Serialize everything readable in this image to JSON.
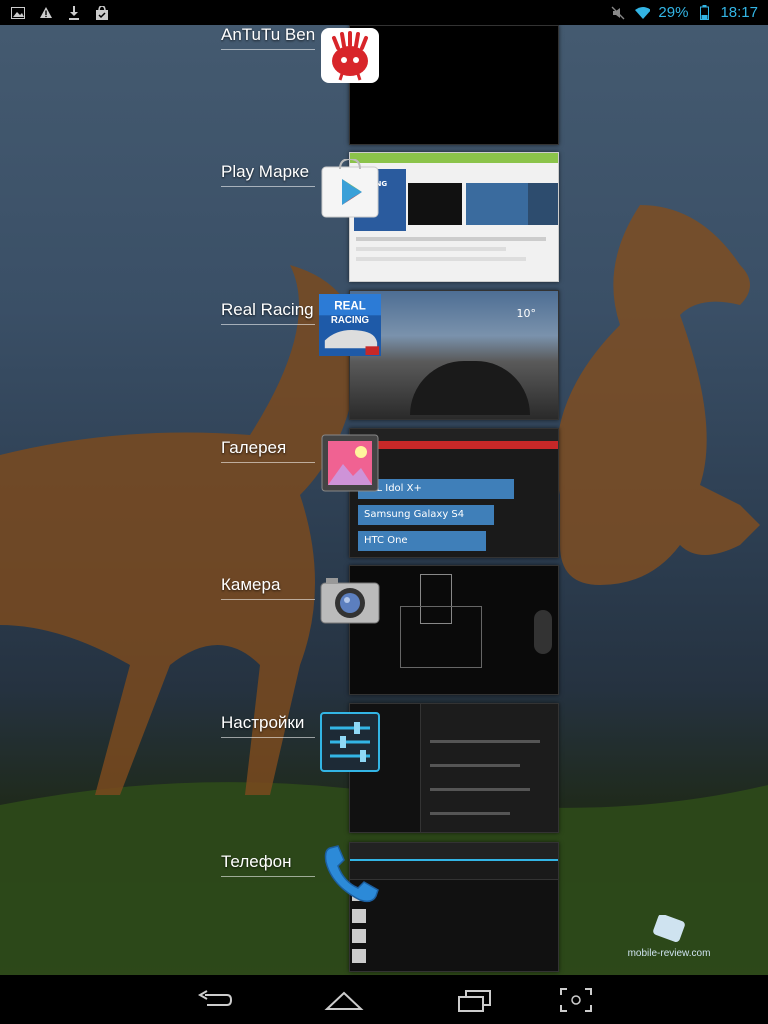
{
  "status_bar": {
    "battery_percent": "29%",
    "time": "18:17",
    "icons": [
      "gallery-notification-icon",
      "warning-icon",
      "download-icon",
      "store-bag-icon",
      "mute-icon",
      "wifi-icon",
      "battery-icon"
    ]
  },
  "recent_apps": [
    {
      "label": "AnTuTu Ben",
      "icon": "antutu-icon"
    },
    {
      "label": "Play Марке",
      "icon": "play-store-icon"
    },
    {
      "label": "Real Racing",
      "icon": "real-racing-icon"
    },
    {
      "label": "Галерея",
      "icon": "gallery-icon"
    },
    {
      "label": "Камера",
      "icon": "camera-icon"
    },
    {
      "label": "Настройки",
      "icon": "settings-icon"
    },
    {
      "label": "Телефон",
      "icon": "phone-icon"
    }
  ],
  "gallery_thumb": {
    "bars": [
      "TCL Idol X+",
      "Samsung Galaxy S4",
      "HTC One"
    ]
  },
  "play_thumb": {
    "banner": "REAL RACING"
  },
  "racing_thumb": {
    "speed": "10°"
  },
  "nav_bar": {
    "buttons": [
      "back-button",
      "home-button",
      "recent-apps-button",
      "screenshot-button"
    ]
  },
  "watermark": "mobile-review.com",
  "colors": {
    "accent": "#33b5e5",
    "status_bar_bg": "#000000",
    "nav_bar_bg": "#000000"
  }
}
